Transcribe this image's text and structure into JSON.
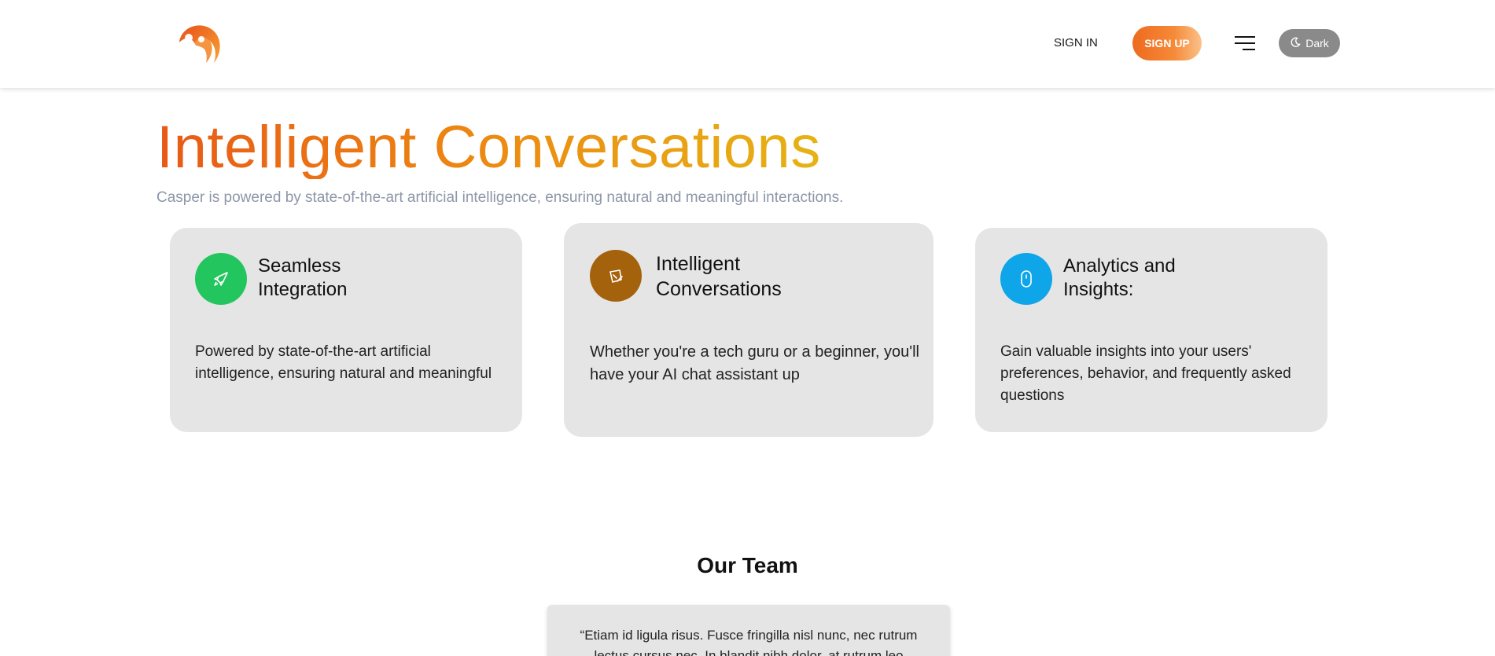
{
  "header": {
    "logo": "casper-logo",
    "signin_label": "SIGN IN",
    "signup_label": "SIGN UP",
    "menu_icon": "hamburger-menu-icon",
    "theme_toggle": {
      "label": "Dark",
      "icon": "moon-icon"
    }
  },
  "colors": {
    "accent_start": "#e85a16",
    "accent_end": "#e6b314",
    "card_bg": "#e5e5e5",
    "green": "#22c55e",
    "brown": "#a4620c",
    "blue": "#0ea5e9"
  },
  "hero": {
    "title": "Intelligent Conversations",
    "subtitle": "Casper is powered by state-of-the-art artificial intelligence, ensuring natural and meaningful interactions."
  },
  "features": [
    {
      "icon": "rocket-icon",
      "title": "Seamless Integration",
      "text": "Powered by state-of-the-art artificial intelligence, ensuring natural and meaningful"
    },
    {
      "icon": "edit-chat-icon",
      "title": "Intelligent Conversations",
      "text": "Whether you're a tech guru or a beginner, you'll have your AI chat assistant up"
    },
    {
      "icon": "mouse-icon",
      "title": "Analytics and Insights:",
      "text": "Gain valuable insights into your users' preferences, behavior, and frequently asked questions"
    }
  ],
  "team": {
    "title": "Our Team",
    "quote": "“Etiam id ligula risus. Fusce fringilla nisl nunc, nec rutrum lectus cursus nec. In blandit nibh dolor, at rutrum leo"
  }
}
